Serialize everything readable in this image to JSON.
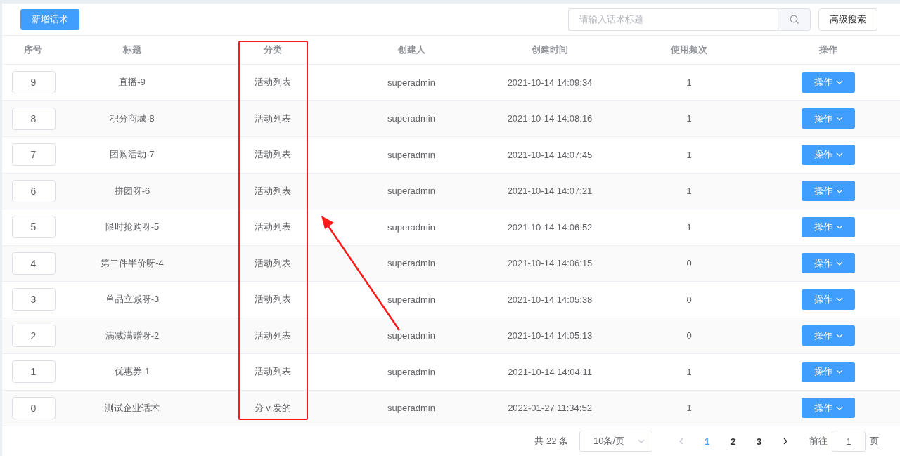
{
  "toolbar": {
    "add_button": "新增话术",
    "search": {
      "placeholder": "请输入话术标题"
    },
    "advanced_button": "高级搜索"
  },
  "table": {
    "columns": [
      "序号",
      "标题",
      "分类",
      "创建人",
      "创建时间",
      "使用频次",
      "操作"
    ],
    "rows": [
      {
        "index": "9",
        "title": "直播-9",
        "category": "活动列表",
        "creator": "superadmin",
        "created": "2021-10-14 14:09:34",
        "uses": "1",
        "action": "操作"
      },
      {
        "index": "8",
        "title": "积分商城-8",
        "category": "活动列表",
        "creator": "superadmin",
        "created": "2021-10-14 14:08:16",
        "uses": "1",
        "action": "操作"
      },
      {
        "index": "7",
        "title": "团购活动-7",
        "category": "活动列表",
        "creator": "superadmin",
        "created": "2021-10-14 14:07:45",
        "uses": "1",
        "action": "操作"
      },
      {
        "index": "6",
        "title": "拼团呀-6",
        "category": "活动列表",
        "creator": "superadmin",
        "created": "2021-10-14 14:07:21",
        "uses": "1",
        "action": "操作"
      },
      {
        "index": "5",
        "title": "限时抢购呀-5",
        "category": "活动列表",
        "creator": "superadmin",
        "created": "2021-10-14 14:06:52",
        "uses": "1",
        "action": "操作"
      },
      {
        "index": "4",
        "title": "第二件半价呀-4",
        "category": "活动列表",
        "creator": "superadmin",
        "created": "2021-10-14 14:06:15",
        "uses": "0",
        "action": "操作"
      },
      {
        "index": "3",
        "title": "单品立减呀-3",
        "category": "活动列表",
        "creator": "superadmin",
        "created": "2021-10-14 14:05:38",
        "uses": "0",
        "action": "操作"
      },
      {
        "index": "2",
        "title": "满减满赠呀-2",
        "category": "活动列表",
        "creator": "superadmin",
        "created": "2021-10-14 14:05:13",
        "uses": "0",
        "action": "操作"
      },
      {
        "index": "1",
        "title": "优惠券-1",
        "category": "活动列表",
        "creator": "superadmin",
        "created": "2021-10-14 14:04:11",
        "uses": "1",
        "action": "操作"
      },
      {
        "index": "0",
        "title": "测试企业话术",
        "category": "分 v 发的",
        "creator": "superadmin",
        "created": "2022-01-27 11:34:52",
        "uses": "1",
        "action": "操作"
      }
    ]
  },
  "pagination": {
    "total": "共 22 条",
    "page_size": "10条/页",
    "pages": [
      {
        "label": "1",
        "selected": true
      },
      {
        "label": "2",
        "selected": false
      },
      {
        "label": "3",
        "selected": false
      }
    ],
    "goto_label": "前往",
    "goto_value": "1",
    "goto_suffix": "页"
  }
}
